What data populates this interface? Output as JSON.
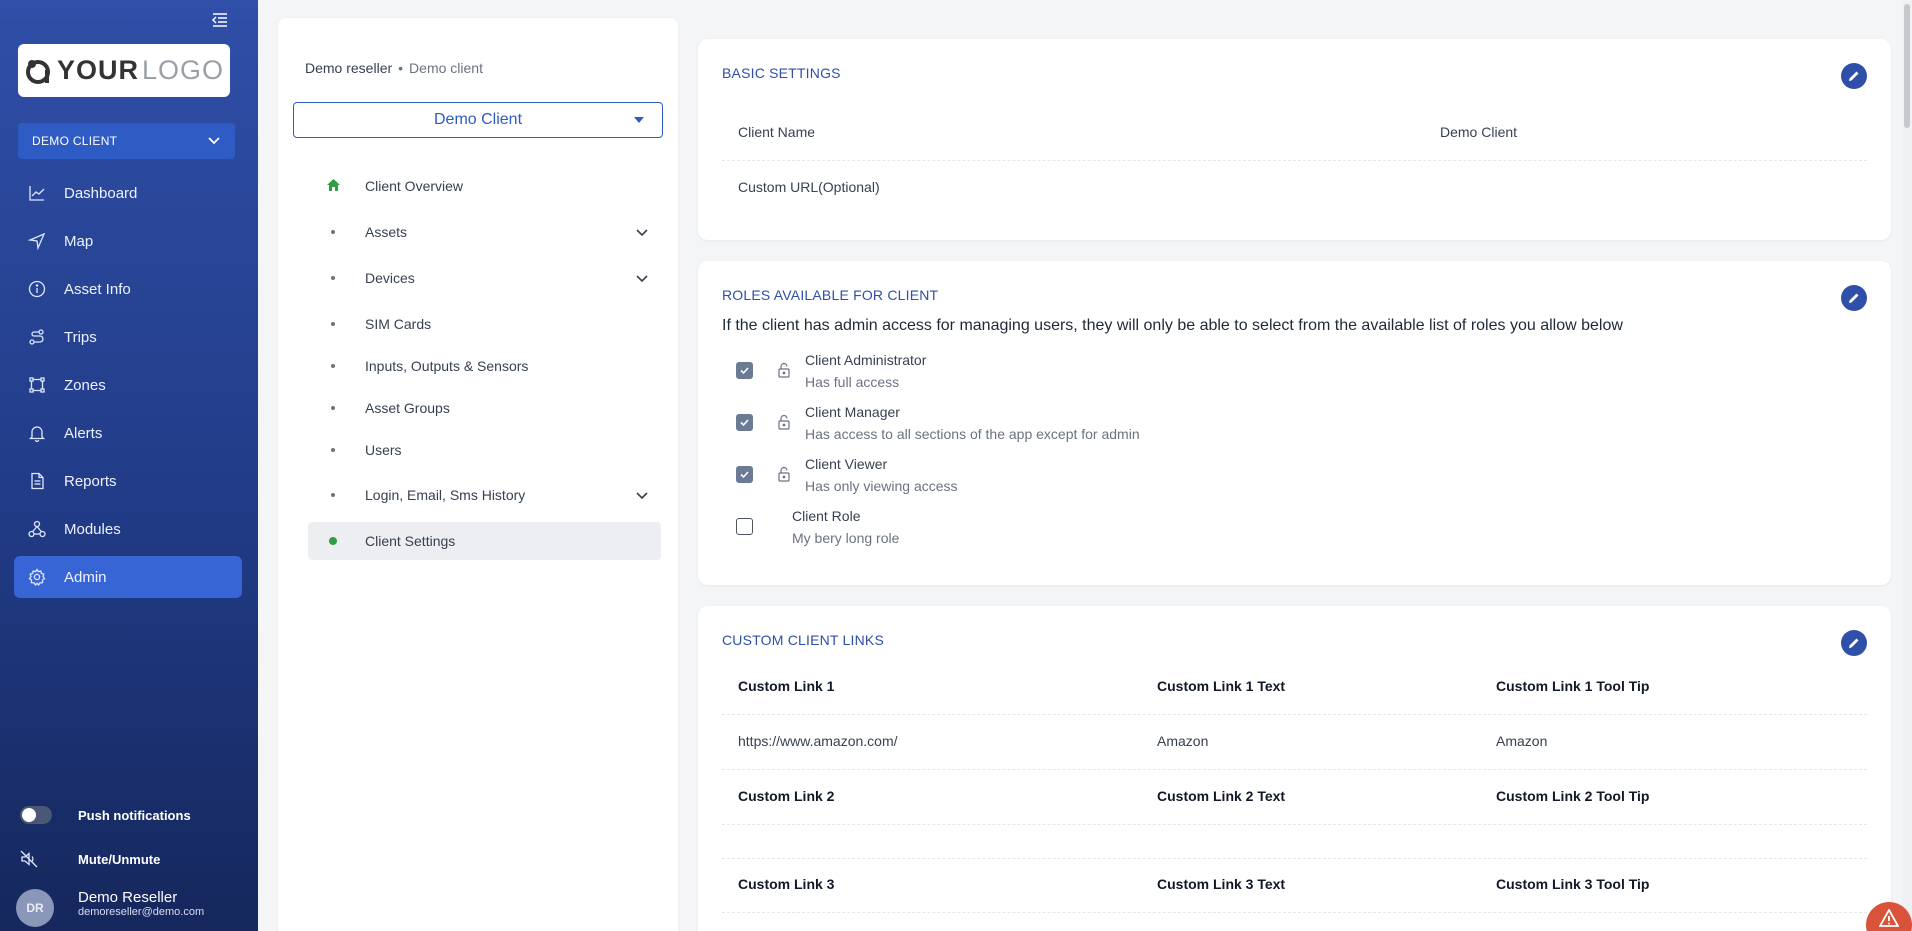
{
  "sidebar": {
    "logo": {
      "bold": "YOUR",
      "light": "LOGO"
    },
    "client_select": "DEMO CLIENT",
    "nav": [
      {
        "label": "Dashboard",
        "icon": "chart-line-icon"
      },
      {
        "label": "Map",
        "icon": "navigation-arrow-icon"
      },
      {
        "label": "Asset Info",
        "icon": "info-circle-icon"
      },
      {
        "label": "Trips",
        "icon": "route-icon"
      },
      {
        "label": "Zones",
        "icon": "zone-polygon-icon"
      },
      {
        "label": "Alerts",
        "icon": "bell-icon"
      },
      {
        "label": "Reports",
        "icon": "document-icon"
      },
      {
        "label": "Modules",
        "icon": "modules-hierarchy-icon"
      },
      {
        "label": "Admin",
        "icon": "gear-icon",
        "active": true
      }
    ],
    "push_notifications": "Push notifications",
    "mute": "Mute/Unmute",
    "user": {
      "initials": "DR",
      "name": "Demo Reseller",
      "email": "demoreseller@demo.com"
    }
  },
  "middle": {
    "breadcrumb": [
      "Demo reseller",
      "Demo client"
    ],
    "client_select": "Demo Client",
    "menu": [
      {
        "label": "Client Overview",
        "kind": "home",
        "expandable": false
      },
      {
        "label": "Assets",
        "kind": "bullet",
        "expandable": true
      },
      {
        "label": "Devices",
        "kind": "bullet",
        "expandable": true
      },
      {
        "label": "SIM Cards",
        "kind": "bullet",
        "expandable": false
      },
      {
        "label": "Inputs, Outputs & Sensors",
        "kind": "bullet",
        "expandable": false
      },
      {
        "label": "Asset Groups",
        "kind": "bullet",
        "expandable": false
      },
      {
        "label": "Users",
        "kind": "bullet",
        "expandable": false
      },
      {
        "label": "Login, Email, Sms History",
        "kind": "bullet",
        "expandable": true
      },
      {
        "label": "Client Settings",
        "kind": "active",
        "expandable": false
      }
    ]
  },
  "basic_settings": {
    "title": "BASIC SETTINGS",
    "rows": [
      {
        "key": "Client Name",
        "value": "Demo Client"
      },
      {
        "key": "Custom URL(Optional)",
        "value": ""
      }
    ]
  },
  "roles": {
    "title": "ROLES AVAILABLE FOR CLIENT",
    "description": "If the client has admin access for managing users, they will only be able to select from the available list of roles you allow below",
    "items": [
      {
        "name": "Client Administrator",
        "desc": "Has full access",
        "checked": true,
        "locked": true
      },
      {
        "name": "Client Manager",
        "desc": "Has access to all sections of the app except for admin",
        "checked": true,
        "locked": true
      },
      {
        "name": "Client Viewer",
        "desc": "Has only viewing access",
        "checked": true,
        "locked": true
      },
      {
        "name": "Client Role",
        "desc": "My bery long role",
        "checked": false,
        "locked": false
      }
    ]
  },
  "custom_links": {
    "title": "CUSTOM CLIENT LINKS",
    "rows": [
      {
        "head": true,
        "c1": "Custom Link 1",
        "c2": "Custom Link 1 Text",
        "c3": "Custom Link 1 Tool Tip"
      },
      {
        "head": false,
        "c1": "https://www.amazon.com/",
        "c2": "Amazon",
        "c3": "Amazon"
      },
      {
        "head": true,
        "c1": "Custom Link 2",
        "c2": "Custom Link 2 Text",
        "c3": "Custom Link 2 Tool Tip"
      },
      {
        "head": false,
        "c1": "",
        "c2": "",
        "c3": ""
      },
      {
        "head": true,
        "c1": "Custom Link 3",
        "c2": "Custom Link 3 Text",
        "c3": "Custom Link 3 Tool Tip"
      }
    ]
  },
  "colors": {
    "brand": "#2f4fa8",
    "accent": "#2f5bc4",
    "active_green": "#2ea043",
    "warning": "#d9533b"
  }
}
